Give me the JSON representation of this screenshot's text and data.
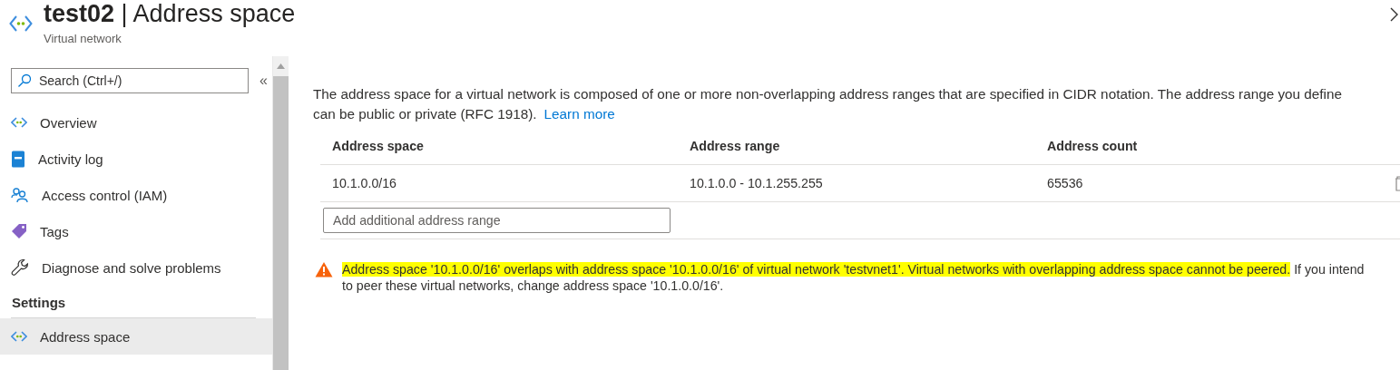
{
  "header": {
    "resource": "test02",
    "separator": "|",
    "page": "Address space",
    "subtitle": "Virtual network"
  },
  "search": {
    "placeholder": "Search (Ctrl+/)"
  },
  "collapse": "«",
  "nav": [
    {
      "label": "Overview",
      "kind": "network",
      "selected": false
    },
    {
      "label": "Activity log",
      "kind": "log",
      "selected": false
    },
    {
      "label": "Access control (IAM)",
      "kind": "people",
      "selected": false
    },
    {
      "label": "Tags",
      "kind": "tag",
      "selected": false
    },
    {
      "label": "Diagnose and solve problems",
      "kind": "wrench",
      "selected": false
    }
  ],
  "sections": [
    {
      "title": "Settings",
      "items": [
        {
          "label": "Address space",
          "kind": "network",
          "selected": true
        }
      ]
    }
  ],
  "description": {
    "line_1": "The address space for a virtual network is composed of one or more non-overlapping address ranges that are specified in CIDR notation. The address range you define",
    "line_2": "can be public or private (RFC 1918).",
    "link": "Learn more"
  },
  "table": {
    "columns": [
      "Address space",
      "Address range",
      "Address count"
    ],
    "rows": [
      [
        "10.1.0.0/16",
        "10.1.0.0 - 10.1.255.255",
        "65536"
      ]
    ]
  },
  "new_range": {
    "placeholder": "Add additional address range"
  },
  "warning": {
    "highlighted": "Address space '10.1.0.0/16' overlaps with address space '10.1.0.0/16' of virtual network 'testvnet1'. Virtual networks with overlapping address space cannot be peered.",
    "rest": "If you intend to peer these virtual networks, change address space '10.1.0.0/16'."
  }
}
